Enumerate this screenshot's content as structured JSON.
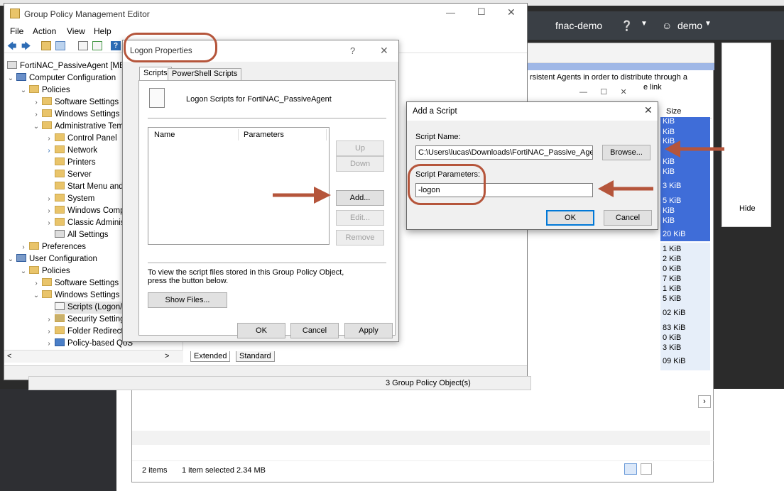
{
  "web": {
    "user_org": "fnac-demo",
    "user_name": "demo",
    "hide_label": "Hide",
    "text_snippet1": "rsistent Agents in order to distribute through a",
    "text_snippet2": "e link",
    "size_header": "Size",
    "sizes_top": [
      "KiB",
      "KiB",
      "KiB",
      "KiB",
      "KiB",
      "3 KiB",
      "5 KiB",
      "KiB",
      "KiB",
      "20 KiB"
    ],
    "sizes_bottom": [
      "1 KiB",
      "2 KiB",
      "0 KiB",
      "7 KiB",
      "1 KiB",
      "5 KiB",
      "02 KiB",
      "83 KiB",
      "0 KiB",
      "3 KiB",
      "09 KiB"
    ],
    "status_items": "2 items",
    "status_selected": "1 item selected  2.34 MB"
  },
  "gpme": {
    "title": "Group Policy Management Editor",
    "menu": [
      "File",
      "Action",
      "View",
      "Help"
    ],
    "tree": [
      "FortiNAC_PassiveAgent [MERCE",
      "Computer Configuration",
      "Policies",
      "Software Settings",
      "Windows Settings",
      "Administrative Temp",
      "Control Panel",
      "Network",
      "Printers",
      "Server",
      "Start Menu and T",
      "System",
      "Windows Compo",
      "Classic Administr",
      "All Settings",
      "Preferences",
      "User Configuration",
      "Policies",
      "Software Settings",
      "Windows Settings",
      "Scripts (Logon/Lo",
      "Security Settings",
      "Folder Redirectio",
      "Policy-based QoS"
    ],
    "tab_extended": "Extended",
    "tab_standard": "Standard",
    "status": "3 Group Policy Object(s)"
  },
  "logon": {
    "title": "Logon Properties",
    "tab_scripts": "Scripts",
    "tab_ps": "PowerShell Scripts",
    "heading": "Logon Scripts for FortiNAC_PassiveAgent",
    "col_name": "Name",
    "col_params": "Parameters",
    "btn_up": "Up",
    "btn_down": "Down",
    "btn_add": "Add...",
    "btn_edit": "Edit...",
    "btn_remove": "Remove",
    "info": "To view the script files stored in this Group Policy Object, press the button below.",
    "btn_show": "Show Files...",
    "btn_ok": "OK",
    "btn_cancel": "Cancel",
    "btn_apply": "Apply"
  },
  "addscript": {
    "title": "Add a Script",
    "name_label": "Script Name:",
    "name_value": "C:\\Users\\lucas\\Downloads\\FortiNAC_Passive_Agent.e",
    "browse": "Browse...",
    "params_label": "Script Parameters:",
    "params_value": "-logon",
    "ok": "OK",
    "cancel": "Cancel"
  },
  "colors": {
    "annotation": "#b5553b",
    "selection": "#3f6dd8",
    "accent": "#0078d7"
  }
}
